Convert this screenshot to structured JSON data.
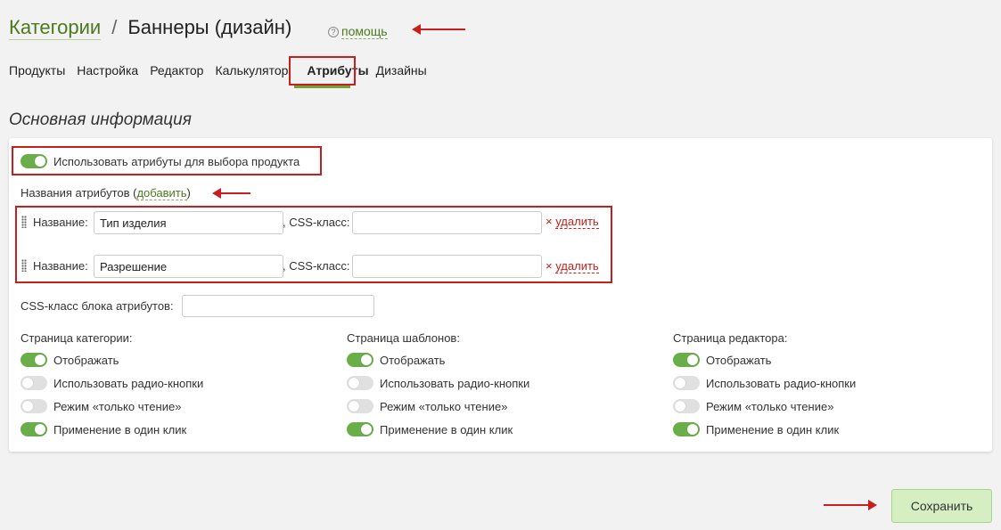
{
  "header": {
    "breadcrumb_link": "Категории",
    "separator": "/",
    "title": "Баннеры (дизайн)",
    "help_icon": "?",
    "help_label": "помощь"
  },
  "tabs": [
    {
      "label": "Продукты"
    },
    {
      "label": "Настройка"
    },
    {
      "label": "Редактор"
    },
    {
      "label": "Калькулятор"
    },
    {
      "label": "Атрибуты",
      "active": true
    },
    {
      "label": "Дизайны"
    }
  ],
  "section_title": "Основная информация",
  "main": {
    "use_attributes": {
      "label": "Использовать атрибуты для выбора продукта",
      "enabled": true
    },
    "names_label_prefix": "Названия атрибутов (",
    "names_add": "добавить",
    "names_label_suffix": ")",
    "attributes": [
      {
        "name_label": "Название:",
        "name_value": "Тип изделия",
        "css_label": ", CSS-класс:",
        "css_value": "",
        "delete_icon": "×",
        "delete_label": "удалить"
      },
      {
        "name_label": "Название:",
        "name_value": "Разрешение",
        "css_label": ", CSS-класс:",
        "css_value": "",
        "delete_icon": "×",
        "delete_label": "удалить"
      }
    ],
    "block_css_label": "CSS-класс блока атрибутов:",
    "block_css_value": "",
    "columns": [
      {
        "title": "Страница категории:",
        "options": [
          {
            "label": "Отображать",
            "enabled": true
          },
          {
            "label": "Использовать радио-кнопки",
            "enabled": false
          },
          {
            "label": "Режим «только чтение»",
            "enabled": false
          },
          {
            "label": "Применение в один клик",
            "enabled": true
          }
        ]
      },
      {
        "title": "Страница шаблонов:",
        "options": [
          {
            "label": "Отображать",
            "enabled": true
          },
          {
            "label": "Использовать радио-кнопки",
            "enabled": false
          },
          {
            "label": "Режим «только чтение»",
            "enabled": false
          },
          {
            "label": "Применение в один клик",
            "enabled": true
          }
        ]
      },
      {
        "title": "Страница редактора:",
        "options": [
          {
            "label": "Отображать",
            "enabled": true
          },
          {
            "label": "Использовать радио-кнопки",
            "enabled": false
          },
          {
            "label": "Режим «только чтение»",
            "enabled": false
          },
          {
            "label": "Применение в один клик",
            "enabled": true
          }
        ]
      }
    ]
  },
  "footer": {
    "save_label": "Сохранить"
  },
  "colors": {
    "accent": "#6aae4a",
    "annotation": "#c81e1e",
    "link": "#4a7a1e"
  }
}
